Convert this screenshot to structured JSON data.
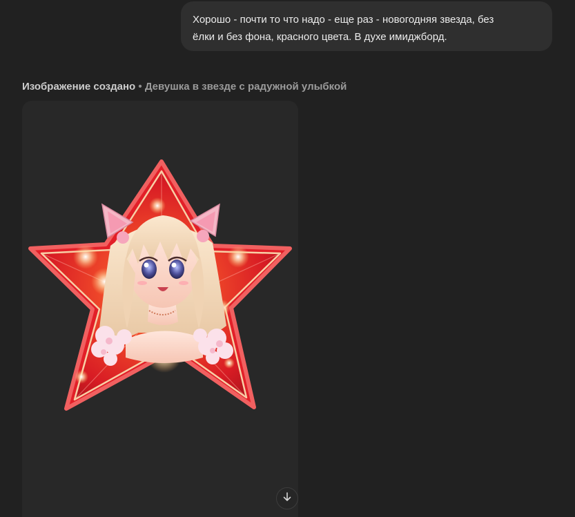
{
  "user_message": {
    "line1": "Хорошо - почти то что надо - еще раз - новогодняя звезда, без",
    "line2": "ёлки и без фона, красного цвета. В духе имиджборд."
  },
  "generation": {
    "status": "Изображение создано",
    "separator": " • ",
    "title": "Девушка в звезде с радужной улыбкой"
  },
  "actions": {
    "download_icon": "arrow-down-icon"
  },
  "colors": {
    "star_red": "#e0232a",
    "star_border": "#f3c7a4",
    "hair": "#f2d7b8",
    "ears": "#f3a1b7"
  }
}
